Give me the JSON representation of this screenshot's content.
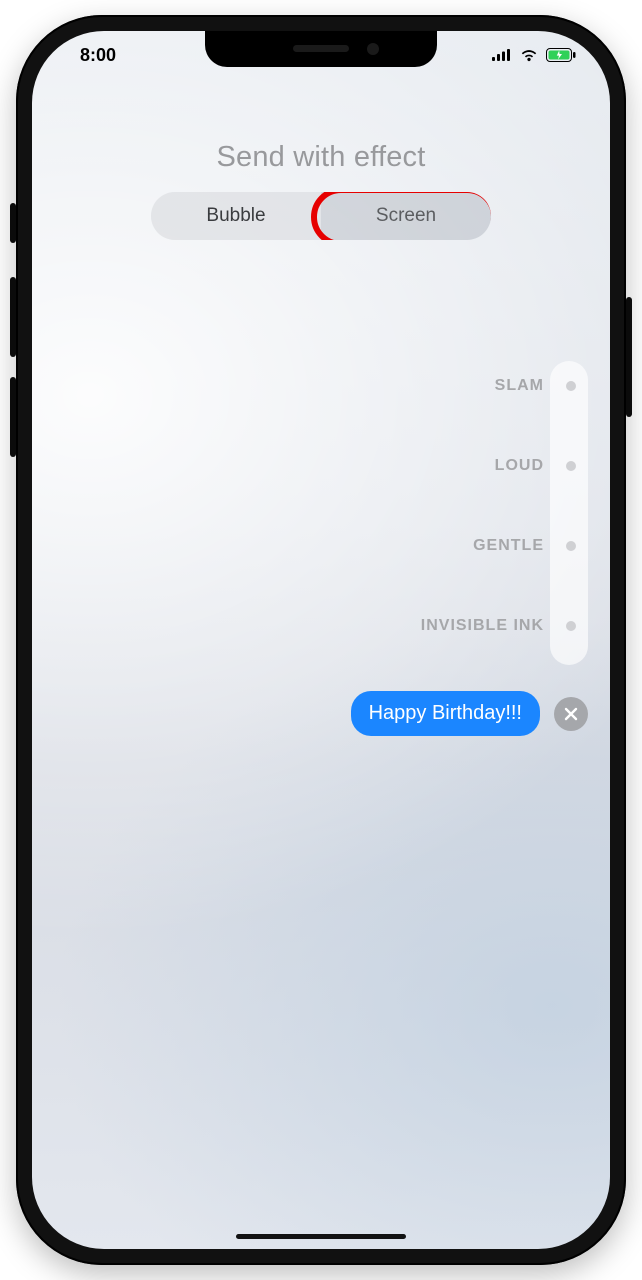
{
  "statusBar": {
    "time": "8:00"
  },
  "title": "Send with effect",
  "segmented": {
    "bubble": "Bubble",
    "screen": "Screen",
    "selected": "bubble"
  },
  "effects": {
    "items": [
      {
        "label": "SLAM"
      },
      {
        "label": "LOUD"
      },
      {
        "label": "GENTLE"
      },
      {
        "label": "INVISIBLE INK"
      }
    ]
  },
  "message": {
    "text": "Happy Birthday!!!"
  },
  "annotation": {
    "highlight": "screen"
  },
  "colors": {
    "accentBlue": "#1b86ff",
    "annotationRed": "#e60000"
  }
}
